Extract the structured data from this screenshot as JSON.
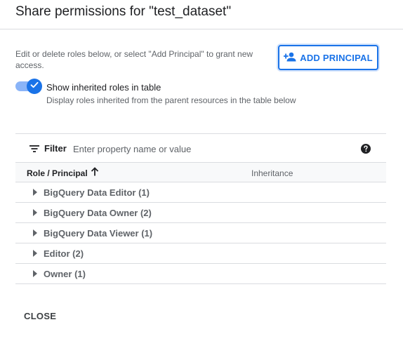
{
  "dialog": {
    "title": "Share permissions for \"test_dataset\"",
    "description": "Edit or delete roles below, or select \"Add Principal\" to grant new access.",
    "add_principal_label": "ADD PRINCIPAL",
    "inherited_toggle": {
      "label": "Show inherited roles in table",
      "sublabel": "Display roles inherited from the parent resources in the table below",
      "checked": true
    },
    "filter": {
      "label": "Filter",
      "placeholder": "Enter property name or value"
    },
    "table": {
      "columns": [
        "Role / Principal",
        "Inheritance"
      ],
      "sort": "ascending",
      "rows": [
        {
          "label": "BigQuery Data Editor (1)"
        },
        {
          "label": "BigQuery Data Owner (2)"
        },
        {
          "label": "BigQuery Data Viewer (1)"
        },
        {
          "label": "Editor (2)"
        },
        {
          "label": "Owner (1)"
        }
      ]
    },
    "close_label": "CLOSE"
  },
  "colors": {
    "accent": "#1a73e8",
    "toggle_track": "#8ab4f8",
    "divider": "#dadce0",
    "secondary_text": "#5f6368"
  },
  "icons": {
    "add_principal": "person-add-icon",
    "toggle": "check-icon",
    "filter": "filter-list-icon",
    "help": "help-icon",
    "sort": "arrow-upward-icon",
    "row_expand": "caret-right-icon"
  }
}
